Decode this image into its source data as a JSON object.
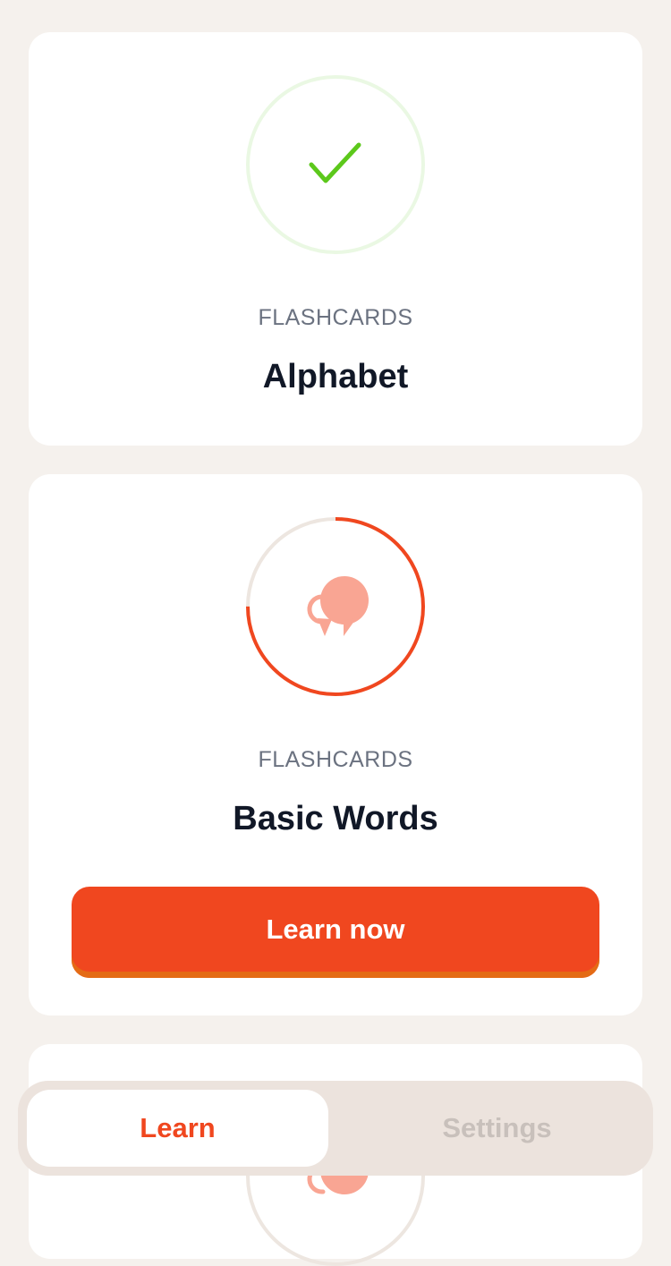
{
  "colors": {
    "page_bg": "#f5f1ed",
    "card_bg": "#ffffff",
    "accent": "#f0471f",
    "success": "#5cc81b",
    "muted_text": "#6b7280",
    "title_text": "#111827"
  },
  "cards": [
    {
      "category": "FLASHCARDS",
      "title": "Alphabet",
      "icon": "checkmark-icon",
      "status": "completed",
      "progress": 1.0
    },
    {
      "category": "FLASHCARDS",
      "title": "Basic Words",
      "icon": "speech-bubbles-icon",
      "status": "in-progress",
      "progress": 0.75,
      "button_label": "Learn now"
    },
    {
      "icon": "speech-bubbles-icon"
    }
  ],
  "tabbar": {
    "tabs": [
      {
        "label": "Learn",
        "active": true
      },
      {
        "label": "Settings",
        "active": false
      }
    ]
  }
}
